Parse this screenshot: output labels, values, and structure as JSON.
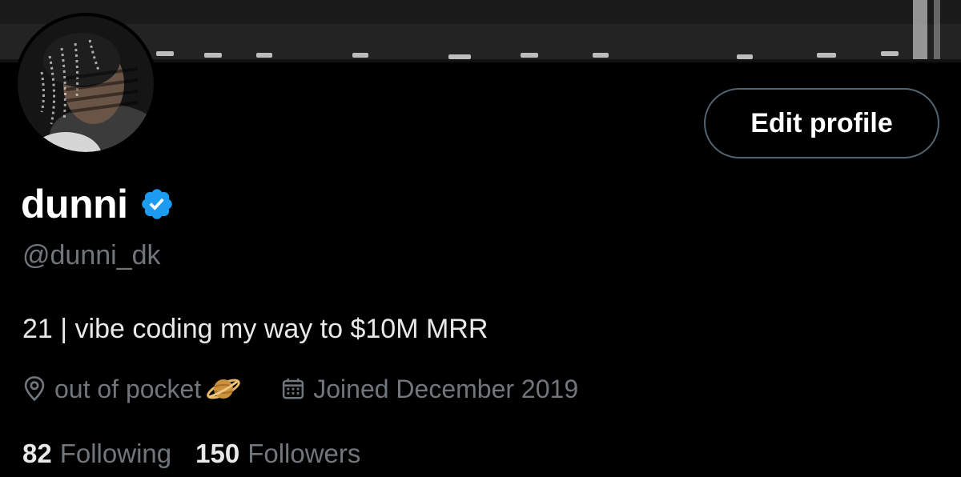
{
  "header": {
    "edit_profile_label": "Edit profile"
  },
  "profile": {
    "display_name": "dunni",
    "verified": true,
    "handle": "@dunni_dk",
    "bio": "21 | vibe coding my way to $10M MRR",
    "location": "out of pocket",
    "location_emoji_icon": "ringed-planet-icon",
    "joined": "Joined December 2019"
  },
  "stats": {
    "following_count": "82",
    "following_label": "Following",
    "followers_count": "150",
    "followers_label": "Followers"
  },
  "colors": {
    "background": "#000000",
    "primary_text": "#e7e9ea",
    "secondary_text": "#71767b",
    "verified_blue": "#1d9bf0",
    "button_border": "#536471"
  }
}
